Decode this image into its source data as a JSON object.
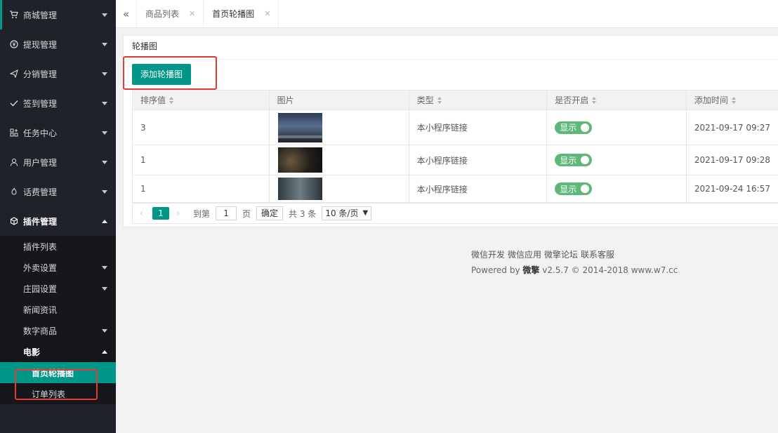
{
  "sidebar": {
    "items": [
      {
        "label": "商城管理",
        "icon": "cart-icon"
      },
      {
        "label": "提现管理",
        "icon": "yen-icon"
      },
      {
        "label": "分销管理",
        "icon": "send-icon"
      },
      {
        "label": "签到管理",
        "icon": "check-icon"
      },
      {
        "label": "任务中心",
        "icon": "apps-icon"
      },
      {
        "label": "用户管理",
        "icon": "user-icon"
      },
      {
        "label": "话费管理",
        "icon": "fire-icon"
      },
      {
        "label": "插件管理",
        "icon": "cube-icon"
      }
    ],
    "plugin_sub": [
      {
        "label": "插件列表"
      },
      {
        "label": "外卖设置"
      },
      {
        "label": "庄园设置"
      },
      {
        "label": "新闻资讯"
      },
      {
        "label": "数字商品"
      },
      {
        "label": "电影"
      }
    ],
    "movie_sub": [
      {
        "label": "首页轮播图"
      },
      {
        "label": "订单列表"
      }
    ]
  },
  "tabs": {
    "back_icon": "double-chevron-left-icon",
    "items": [
      {
        "label": "商品列表"
      },
      {
        "label": "首页轮播图"
      }
    ]
  },
  "card": {
    "title": "轮播图",
    "add_button": "添加轮播图"
  },
  "table": {
    "columns": [
      "排序值",
      "图片",
      "类型",
      "是否开启",
      "添加时间"
    ],
    "rows": [
      {
        "sort": "3",
        "type": "本小程序链接",
        "status": "显示",
        "time": "2021-09-17 09:27"
      },
      {
        "sort": "1",
        "type": "本小程序链接",
        "status": "显示",
        "time": "2021-09-17 09:28"
      },
      {
        "sort": "1",
        "type": "本小程序链接",
        "status": "显示",
        "time": "2021-09-24 16:57"
      }
    ]
  },
  "pager": {
    "current": "1",
    "goto_label": "到第",
    "goto_value": "1",
    "page_label": "页",
    "confirm": "确定",
    "total": "共 3 条",
    "size": "10 条/页"
  },
  "footer": {
    "links": [
      "微信开发",
      "微信应用",
      "微擎论坛",
      "联系客服"
    ],
    "powered_prefix": "Powered by",
    "brand": "微擎",
    "powered_suffix": "v2.5.7 © 2014-2018 www.w7.cc"
  },
  "colors": {
    "accent": "#009688",
    "sidebar_bg": "#20222a",
    "switch_on": "#5fb878",
    "highlight": "#e53935"
  }
}
